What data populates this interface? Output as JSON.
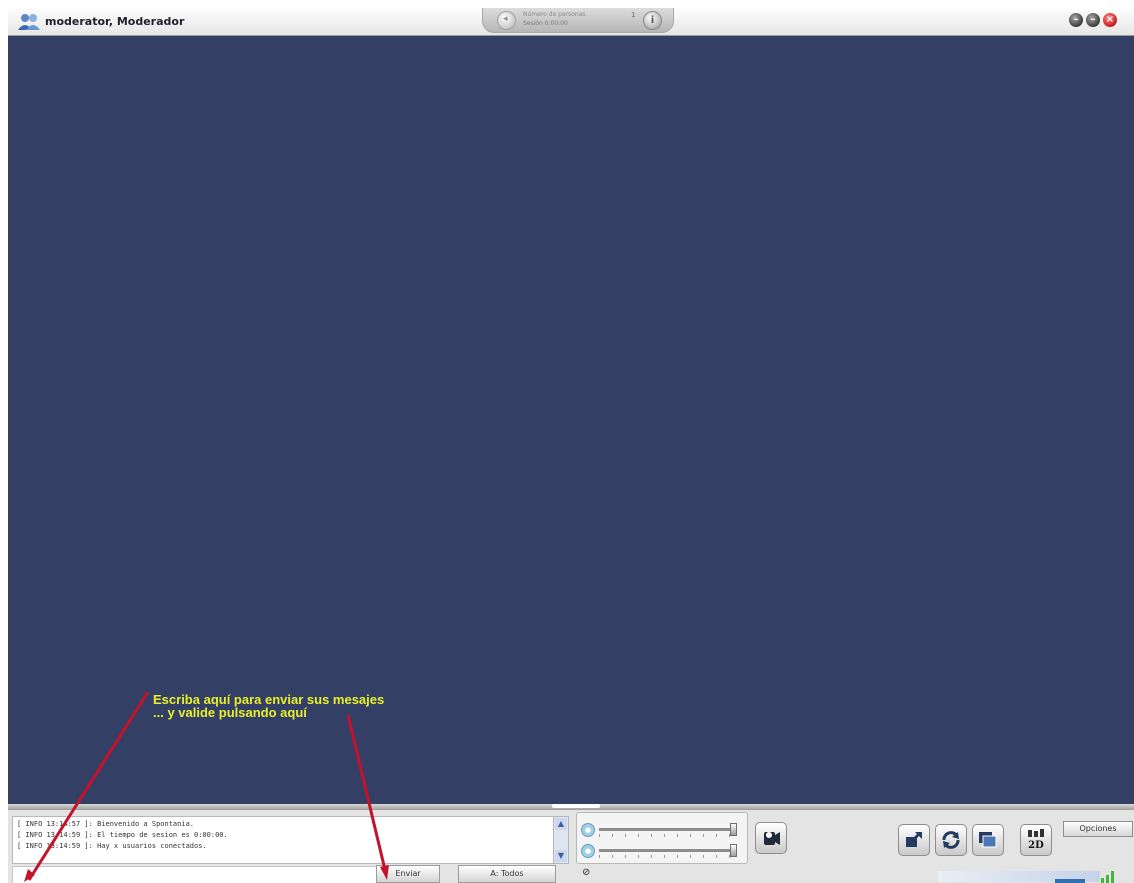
{
  "titlebar": {
    "user_title": "moderator, Moderador",
    "center_tab_line1": "Número de personas",
    "center_tab_line2": "Sesión 0:00:00",
    "center_tab_count": "1"
  },
  "hints": {
    "line1": "Escriba aquí para enviar sus mesajes",
    "line2": "... y valide pulsando aquí"
  },
  "chat": {
    "log": [
      "[ INFO 13:14:57 ]: Bienvenido a Spontania.",
      "[ INFO 13:14:59 ]: El tiempo de sesion es 0:00:00.",
      "[ INFO 13:14:59 ]: Hay x usuarios conectados."
    ],
    "send_label": "Enviar",
    "recipient_label": "A: Todos",
    "message_placeholder": ""
  },
  "audio": {
    "microphone_level": 0.97,
    "speaker_level": 0.97
  },
  "toolbar": {
    "view_mode_label": "2D",
    "options_label": "Opciones"
  },
  "colors": {
    "viewport": "#343f66",
    "hint_text": "#e9f02a",
    "annotation_arrow": "#c4122b",
    "close_button": "#c21313"
  },
  "icons": [
    "user-group-icon",
    "minimize-icon",
    "maximize-icon",
    "close-icon",
    "info-icon",
    "camera-icon",
    "fullscreen-icon",
    "refresh-icon",
    "layers-icon",
    "view-2d-icon",
    "microphone-icon",
    "speaker-icon"
  ]
}
